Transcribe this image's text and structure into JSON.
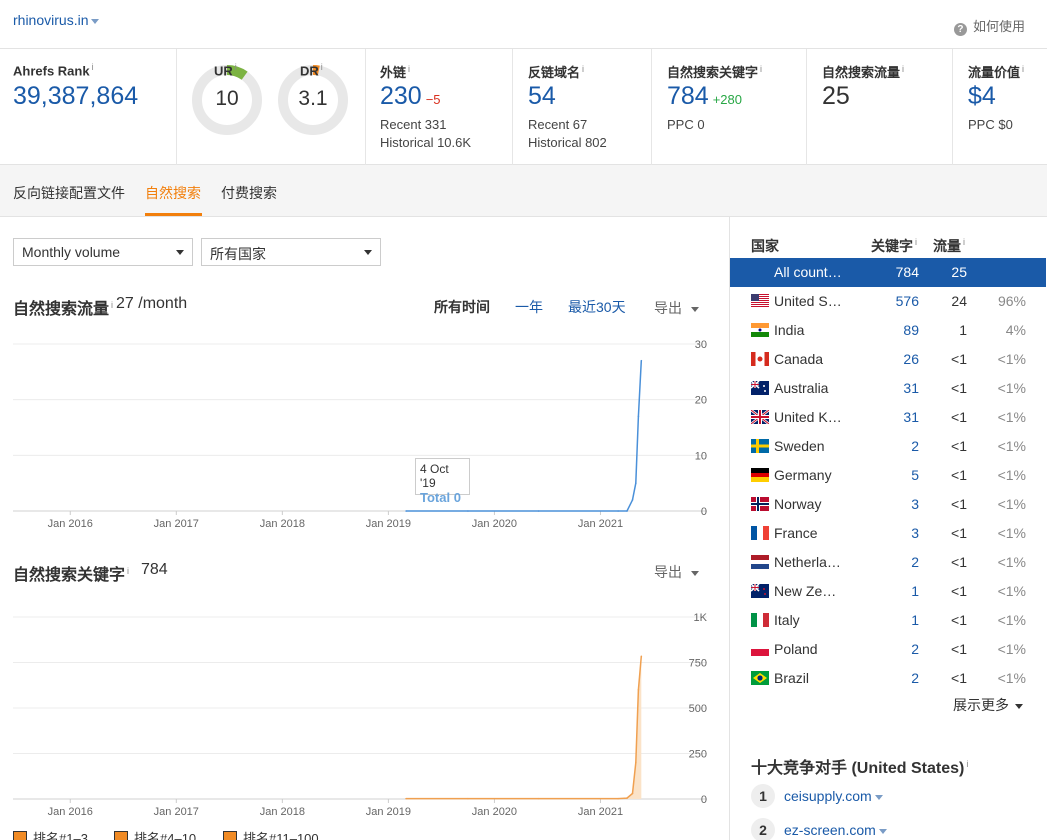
{
  "header": {
    "domain": "rhinovirus.in",
    "help_label": "如何使用"
  },
  "metrics": {
    "ahrefs_rank": {
      "label": "Ahrefs Rank",
      "value": "39,387,864"
    },
    "ur": {
      "label": "UR",
      "value": "10",
      "fill": 0.1,
      "color": "#7cb342"
    },
    "dr": {
      "label": "DR",
      "value": "3.1",
      "fill": 0.031,
      "color": "#f08a24"
    },
    "backlinks": {
      "label": "外链",
      "value": "230",
      "delta": "−5",
      "recent": "Recent 331",
      "historical": "Historical 10.6K"
    },
    "ref_domains": {
      "label": "反链域名",
      "value": "54",
      "recent": "Recent 67",
      "historical": "Historical 802"
    },
    "organic_keywords": {
      "label": "自然搜索关键字",
      "value": "784",
      "delta": "+280",
      "ppc": "PPC 0"
    },
    "organic_traffic": {
      "label": "自然搜索流量",
      "value": "25"
    },
    "traffic_value": {
      "label": "流量价值",
      "value": "$4",
      "ppc": "PPC $0"
    }
  },
  "tabs": [
    "反向链接配置文件",
    "自然搜索",
    "付费搜索"
  ],
  "filters": {
    "volume": "Monthly volume",
    "country": "所有国家"
  },
  "traffic_section": {
    "title": "自然搜索流量",
    "value": "27 /month",
    "time_options": [
      "所有时间",
      "一年",
      "最近30天"
    ],
    "export": "导出",
    "tooltip_date": "4 Oct '19",
    "tooltip_total": "Total 0"
  },
  "keywords_section": {
    "title": "自然搜索关键字",
    "value": "784",
    "export": "导出"
  },
  "legend": [
    "排名#1–3",
    "排名#4–10",
    "排名#11–100"
  ],
  "chart_data": [
    {
      "type": "line",
      "title": "自然搜索流量",
      "x_ticks": [
        "Jan 2016",
        "Jan 2017",
        "Jan 2018",
        "Jan 2019",
        "Jan 2020",
        "Jan 2021"
      ],
      "y_ticks": [
        "30",
        "20",
        "10",
        "0"
      ],
      "ylim": [
        0,
        30
      ],
      "color": "#4a90d9",
      "series": [
        {
          "x": [
            "2019-03",
            "2019-10",
            "2020-06",
            "2021-03",
            "2021-04",
            "2021-04-20",
            "2021-05-01",
            "2021-05-10",
            "2021-05-20"
          ],
          "y": [
            0,
            0,
            0,
            0,
            0,
            2,
            5,
            17,
            27
          ]
        }
      ]
    },
    {
      "type": "area",
      "title": "自然搜索关键字",
      "x_ticks": [
        "Jan 2016",
        "Jan 2017",
        "Jan 2018",
        "Jan 2019",
        "Jan 2020",
        "Jan 2021"
      ],
      "y_ticks": [
        "1K",
        "750",
        "500",
        "250",
        "0"
      ],
      "ylim": [
        0,
        1000
      ],
      "color": "#f0a050",
      "series": [
        {
          "x": [
            "2019-03",
            "2019-10",
            "2020-06",
            "2021-03",
            "2021-04",
            "2021-04-20",
            "2021-05-01",
            "2021-05-10",
            "2021-05-20"
          ],
          "y": [
            2,
            2,
            2,
            2,
            5,
            30,
            200,
            600,
            784
          ]
        }
      ]
    }
  ],
  "countries": {
    "headers": [
      "国家",
      "关键字",
      "流量"
    ],
    "rows": [
      {
        "name": "All count…",
        "kw": "784",
        "tr": "25",
        "pct": "",
        "flag": "none",
        "sel": true
      },
      {
        "name": "United S…",
        "kw": "576",
        "tr": "24",
        "pct": "96%",
        "flag": "us"
      },
      {
        "name": "India",
        "kw": "89",
        "tr": "1",
        "pct": "4%",
        "flag": "in"
      },
      {
        "name": "Canada",
        "kw": "26",
        "tr": "<1",
        "pct": "<1%",
        "flag": "ca"
      },
      {
        "name": "Australia",
        "kw": "31",
        "tr": "<1",
        "pct": "<1%",
        "flag": "au"
      },
      {
        "name": "United K…",
        "kw": "31",
        "tr": "<1",
        "pct": "<1%",
        "flag": "gb"
      },
      {
        "name": "Sweden",
        "kw": "2",
        "tr": "<1",
        "pct": "<1%",
        "flag": "se"
      },
      {
        "name": "Germany",
        "kw": "5",
        "tr": "<1",
        "pct": "<1%",
        "flag": "de"
      },
      {
        "name": "Norway",
        "kw": "3",
        "tr": "<1",
        "pct": "<1%",
        "flag": "no"
      },
      {
        "name": "France",
        "kw": "3",
        "tr": "<1",
        "pct": "<1%",
        "flag": "fr"
      },
      {
        "name": "Netherla…",
        "kw": "2",
        "tr": "<1",
        "pct": "<1%",
        "flag": "nl"
      },
      {
        "name": "New Ze…",
        "kw": "1",
        "tr": "<1",
        "pct": "<1%",
        "flag": "nz"
      },
      {
        "name": "Italy",
        "kw": "1",
        "tr": "<1",
        "pct": "<1%",
        "flag": "it"
      },
      {
        "name": "Poland",
        "kw": "2",
        "tr": "<1",
        "pct": "<1%",
        "flag": "pl"
      },
      {
        "name": "Brazil",
        "kw": "2",
        "tr": "<1",
        "pct": "<1%",
        "flag": "br"
      }
    ],
    "show_more": "展示更多"
  },
  "competitors": {
    "title": "十大竞争对手 (United States)",
    "items": [
      {
        "rank": "1",
        "domain": "ceisupply.com"
      },
      {
        "rank": "2",
        "domain": "ez-screen.com"
      }
    ]
  }
}
